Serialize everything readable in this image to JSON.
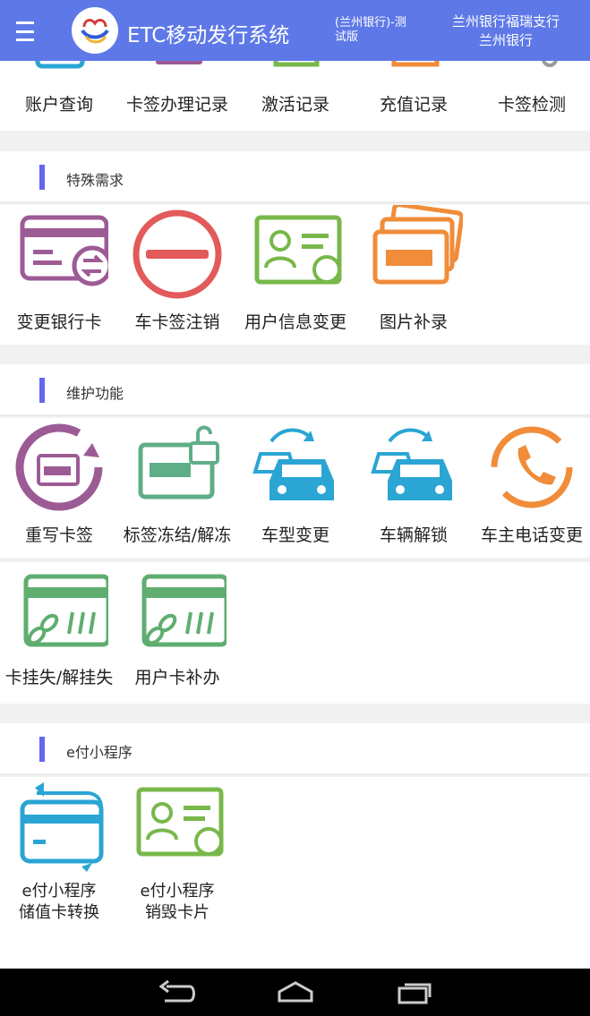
{
  "header": {
    "app_title": "ETC移动发行系统",
    "env": "(兰州银行)-测试版",
    "branch": "兰州银行福瑞支行",
    "bank": "兰州银行"
  },
  "top_row": [
    {
      "label": "账户查询",
      "icon": "account-query-icon"
    },
    {
      "label": "卡签办理记录",
      "icon": "card-record-icon"
    },
    {
      "label": "激活记录",
      "icon": "activation-record-icon"
    },
    {
      "label": "充值记录",
      "icon": "recharge-record-icon"
    },
    {
      "label": "卡签检测",
      "icon": "card-check-icon"
    }
  ],
  "sections": [
    {
      "title": "特殊需求",
      "items": [
        {
          "label": "变更银行卡",
          "icon": "change-bank-card-icon",
          "color": "#9d5b95"
        },
        {
          "label": "车卡签注销",
          "icon": "cancel-icon",
          "color": "#e25a5a"
        },
        {
          "label": "用户信息变更",
          "icon": "user-info-change-icon",
          "color": "#78b84a"
        },
        {
          "label": "图片补录",
          "icon": "photo-supplement-icon",
          "color": "#f08c3a"
        }
      ]
    },
    {
      "title": "维护功能",
      "items": [
        {
          "label": "重写卡签",
          "icon": "rewrite-card-icon",
          "color": "#9d5b95"
        },
        {
          "label": "标签冻结/解冻",
          "icon": "tag-freeze-icon",
          "color": "#5fae88"
        },
        {
          "label": "车型变更",
          "icon": "car-type-change-icon",
          "color": "#2aa5d4"
        },
        {
          "label": "车辆解锁",
          "icon": "vehicle-unlock-icon",
          "color": "#2aa5d4"
        },
        {
          "label": "车主电话变更",
          "icon": "phone-change-icon",
          "color": "#f08c3a"
        },
        {
          "label": "卡挂失/解挂失",
          "icon": "card-loss-icon",
          "color": "#5fae70"
        },
        {
          "label": "用户卡补办",
          "icon": "card-reissue-icon",
          "color": "#5fae70"
        }
      ]
    },
    {
      "title": "e付小程序",
      "items": [
        {
          "label": "e付小程序",
          "label2": "储值卡转换",
          "icon": "card-convert-icon",
          "color": "#2aa5d4"
        },
        {
          "label": "e付小程序",
          "label2": "销毁卡片",
          "icon": "card-destroy-icon",
          "color": "#78b84a"
        }
      ]
    }
  ],
  "navbar": {
    "back": "back-icon",
    "home": "home-icon",
    "recent": "recent-apps-icon"
  }
}
